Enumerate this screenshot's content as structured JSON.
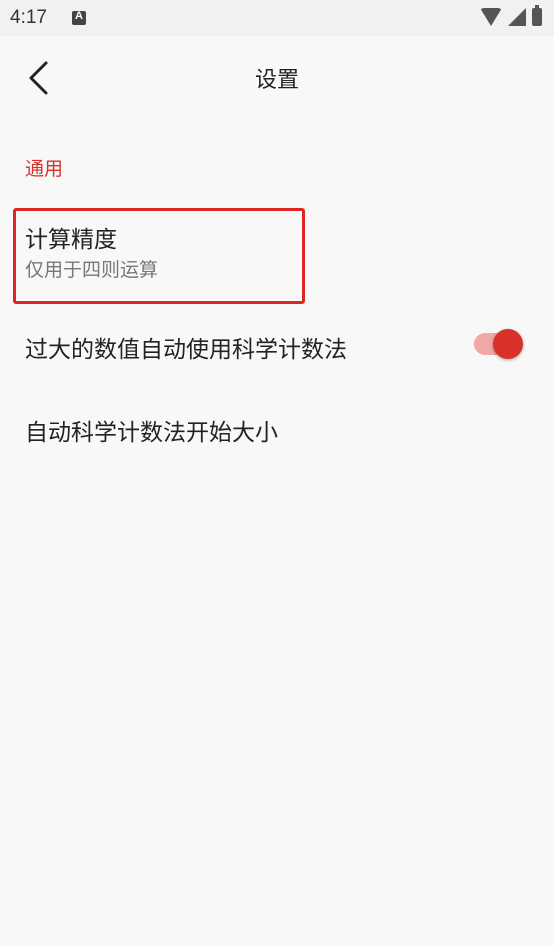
{
  "status_bar": {
    "time": "4:17"
  },
  "header": {
    "title": "设置"
  },
  "sections": [
    {
      "header": "通用",
      "items": [
        {
          "title": "计算精度",
          "summary": "仅用于四则运算"
        },
        {
          "title": "过大的数值自动使用科学计数法",
          "switch_on": true
        },
        {
          "title": "自动科学计数法开始大小"
        }
      ]
    }
  ],
  "colors": {
    "accent": "#d9302a",
    "switch_track": "#f2a9a6",
    "highlight_border": "#e02424",
    "background": "#f8f8f8"
  }
}
